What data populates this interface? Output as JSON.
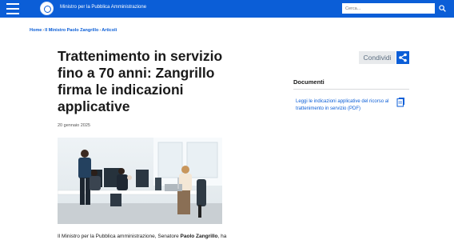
{
  "header": {
    "site_title": "Ministro per la Pubblica Amministrazione",
    "search_placeholder": "Cerca...",
    "menu_icon": "hamburger-menu-icon",
    "emblem_icon": "republic-emblem-icon",
    "search_icon": "magnifier-icon"
  },
  "breadcrumb": {
    "items": [
      "Home",
      "Il Ministro Paolo Zangrillo",
      "Articoli"
    ],
    "separator": "›"
  },
  "article": {
    "title": "Trattenimento in servizio fino a 70 anni: Zangrillo firma le indicazioni applicative",
    "date": "20 gennaio 2025",
    "body_prefix": "Il Ministro per la Pubblica amministrazione, Senatore ",
    "body_bold": "Paolo Zangrillo",
    "body_suffix": ", ha"
  },
  "share": {
    "label": "Condividi",
    "icon": "share-icon"
  },
  "documents": {
    "title": "Documenti",
    "items": [
      {
        "label": "Leggi le indicazioni applicative del ricorso al trattenimento in servizio (PDF)",
        "icon": "document-icon"
      }
    ]
  },
  "colors": {
    "brand_blue": "#0b5ed7",
    "text": "#1a1a1a",
    "muted": "#555555",
    "share_bg": "#e8eaec"
  }
}
